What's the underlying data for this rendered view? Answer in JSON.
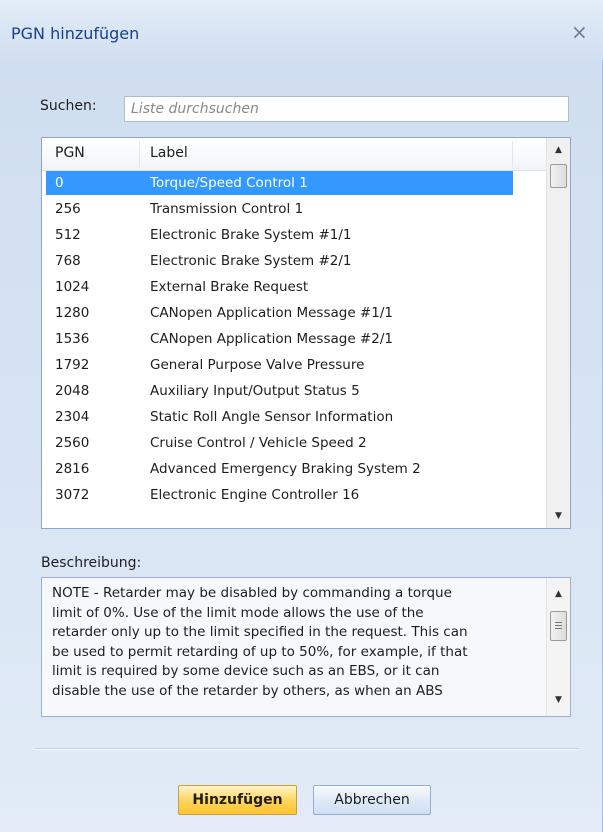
{
  "window": {
    "title": "PGN hinzufügen"
  },
  "icons": {
    "close": "×",
    "scroll_up": "▲",
    "scroll_down": "▼"
  },
  "search": {
    "label": "Suchen:",
    "placeholder": "Liste durchsuchen",
    "value": ""
  },
  "list": {
    "columns": [
      "PGN",
      "Label"
    ],
    "selected_index": 0,
    "rows": [
      {
        "pgn": "0",
        "label": "Torque/Speed Control 1"
      },
      {
        "pgn": "256",
        "label": "Transmission Control 1"
      },
      {
        "pgn": "512",
        "label": "Electronic Brake System #1/1"
      },
      {
        "pgn": "768",
        "label": "Electronic Brake System #2/1"
      },
      {
        "pgn": "1024",
        "label": "External Brake Request"
      },
      {
        "pgn": "1280",
        "label": "CANopen Application Message #1/1"
      },
      {
        "pgn": "1536",
        "label": "CANopen Application Message #2/1"
      },
      {
        "pgn": "1792",
        "label": "General Purpose Valve Pressure"
      },
      {
        "pgn": "2048",
        "label": "Auxiliary Input/Output Status 5"
      },
      {
        "pgn": "2304",
        "label": "Static Roll Angle Sensor Information"
      },
      {
        "pgn": "2560",
        "label": "Cruise Control / Vehicle Speed 2"
      },
      {
        "pgn": "2816",
        "label": "Advanced Emergency Braking System 2"
      },
      {
        "pgn": "3072",
        "label": "Electronic Engine Controller 16"
      }
    ]
  },
  "description": {
    "label": "Beschreibung:",
    "text": "NOTE - Retarder may be disabled by commanding a torque\nlimit of 0%.  Use of the limit mode allows the use of the\nretarder only up to the limit specified in the request.  This can\nbe used to permit retarding of up to 50%, for example, if that\nlimit is required by some device such as an EBS, or it can\ndisable the use of the retarder by others, as when an ABS"
  },
  "buttons": {
    "add": "Hinzufügen",
    "cancel": "Abbrechen"
  },
  "colors": {
    "selection": "#3399ff",
    "title_text": "#15428b",
    "primary_button": "#ffd35a"
  }
}
